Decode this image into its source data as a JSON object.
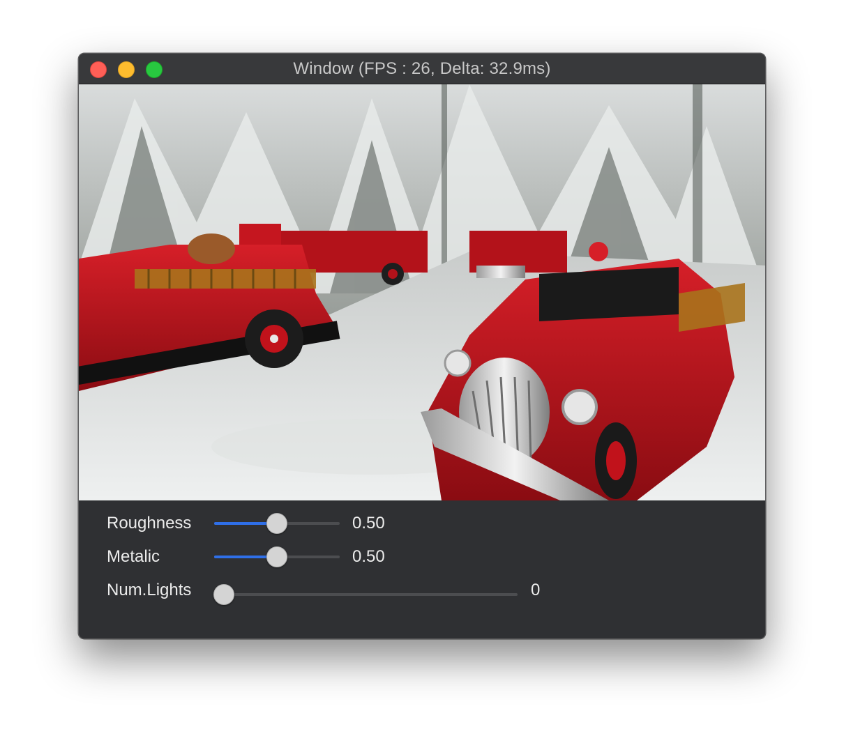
{
  "window": {
    "title": "Window (FPS : 26, Delta: 32.9ms)",
    "buttons": [
      "close",
      "minimize",
      "maximize"
    ]
  },
  "scene": {
    "description_icon": "3d-render-viewport"
  },
  "controls": {
    "roughness": {
      "label": "Roughness",
      "value_text": "0.50",
      "fraction": 0.5
    },
    "metalic": {
      "label": "Metalic",
      "value_text": "0.50",
      "fraction": 0.5
    },
    "num_lights": {
      "label": "Num.Lights",
      "value_text": "0",
      "fraction": 0.0
    }
  },
  "colors": {
    "accent": "#2f6fe8",
    "close": "#fe5f57",
    "minimize": "#febc2e",
    "maximize": "#28c840"
  }
}
